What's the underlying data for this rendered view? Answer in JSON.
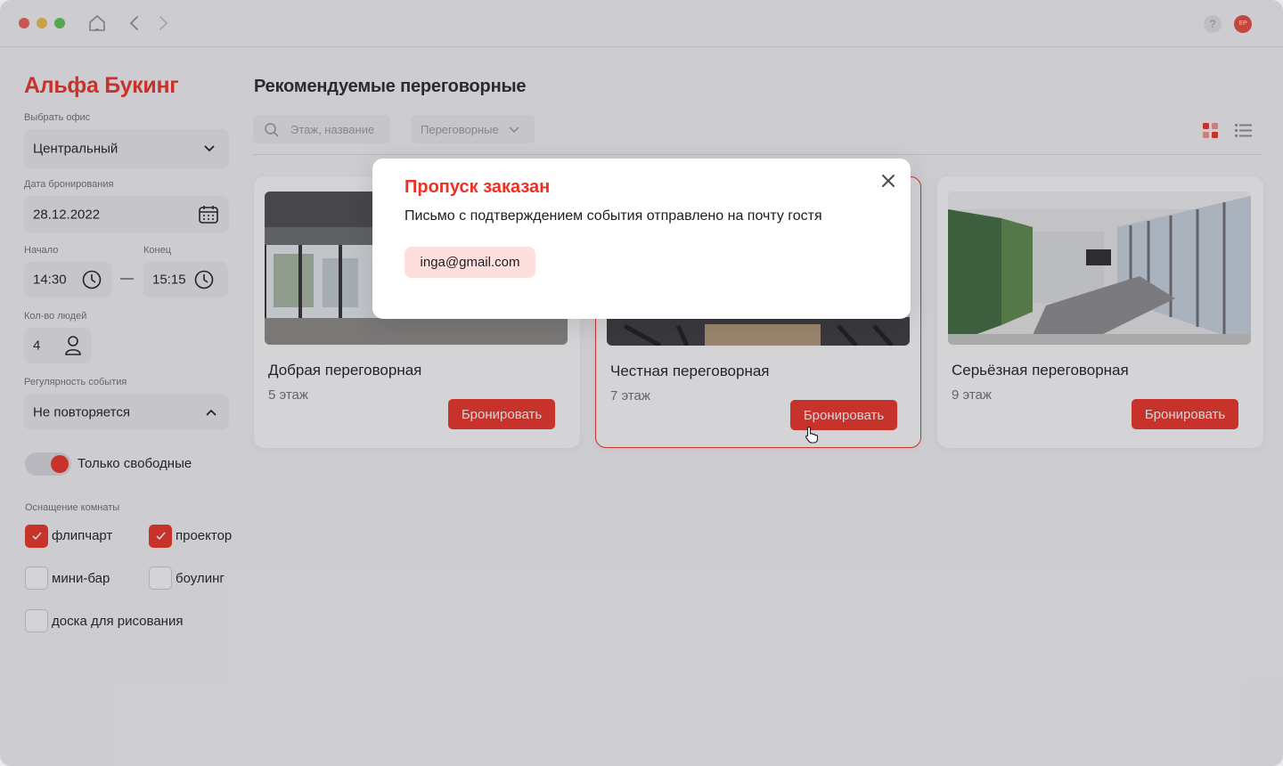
{
  "titlebar": {
    "avatar_initials": "ЕР",
    "help_label": "?"
  },
  "sidebar": {
    "brand": "Альфа Букинг",
    "office_label": "Выбрать офис",
    "office_value": "Центральный",
    "date_label": "Дата бронирования",
    "date_value": "28.12.2022",
    "start_label": "Начало",
    "start_value": "14:30",
    "end_label": "Конец",
    "end_value": "15:15",
    "range_dash": "—",
    "people_label": "Кол-во людей",
    "people_value": "4",
    "recurrence_label": "Регулярность события",
    "recurrence_value": "Не повторяется",
    "only_free_label": "Только свободные",
    "only_free_on": true,
    "equipment_label": "Оснащение комнаты",
    "equipment": [
      {
        "label": "флипчарт",
        "checked": true
      },
      {
        "label": "проектор",
        "checked": true
      },
      {
        "label": "мини-бар",
        "checked": false
      },
      {
        "label": "боулинг",
        "checked": false
      },
      {
        "label": "доска для рисования",
        "checked": false
      }
    ]
  },
  "main": {
    "title": "Рекомендуемые переговорные",
    "search_placeholder": "Этаж, название",
    "filter_label": "Переговорные",
    "rooms": [
      {
        "name": "Добрая переговорная",
        "floor": "5 этаж",
        "button": "Бронировать"
      },
      {
        "name": "Честная переговорная",
        "floor": "7 этаж",
        "button": "Бронировать"
      },
      {
        "name": "Серьёзная переговорная",
        "floor": "9 этаж",
        "button": "Бронировать"
      }
    ]
  },
  "modal": {
    "title": "Пропуск заказан",
    "message": "Письмо с подтверждением события отправлено на почту гостя",
    "email": "inga@gmail.com"
  },
  "colors": {
    "accent": "#ef3124",
    "chip_bg": "#fde0de",
    "field_bg": "#ededf0"
  }
}
